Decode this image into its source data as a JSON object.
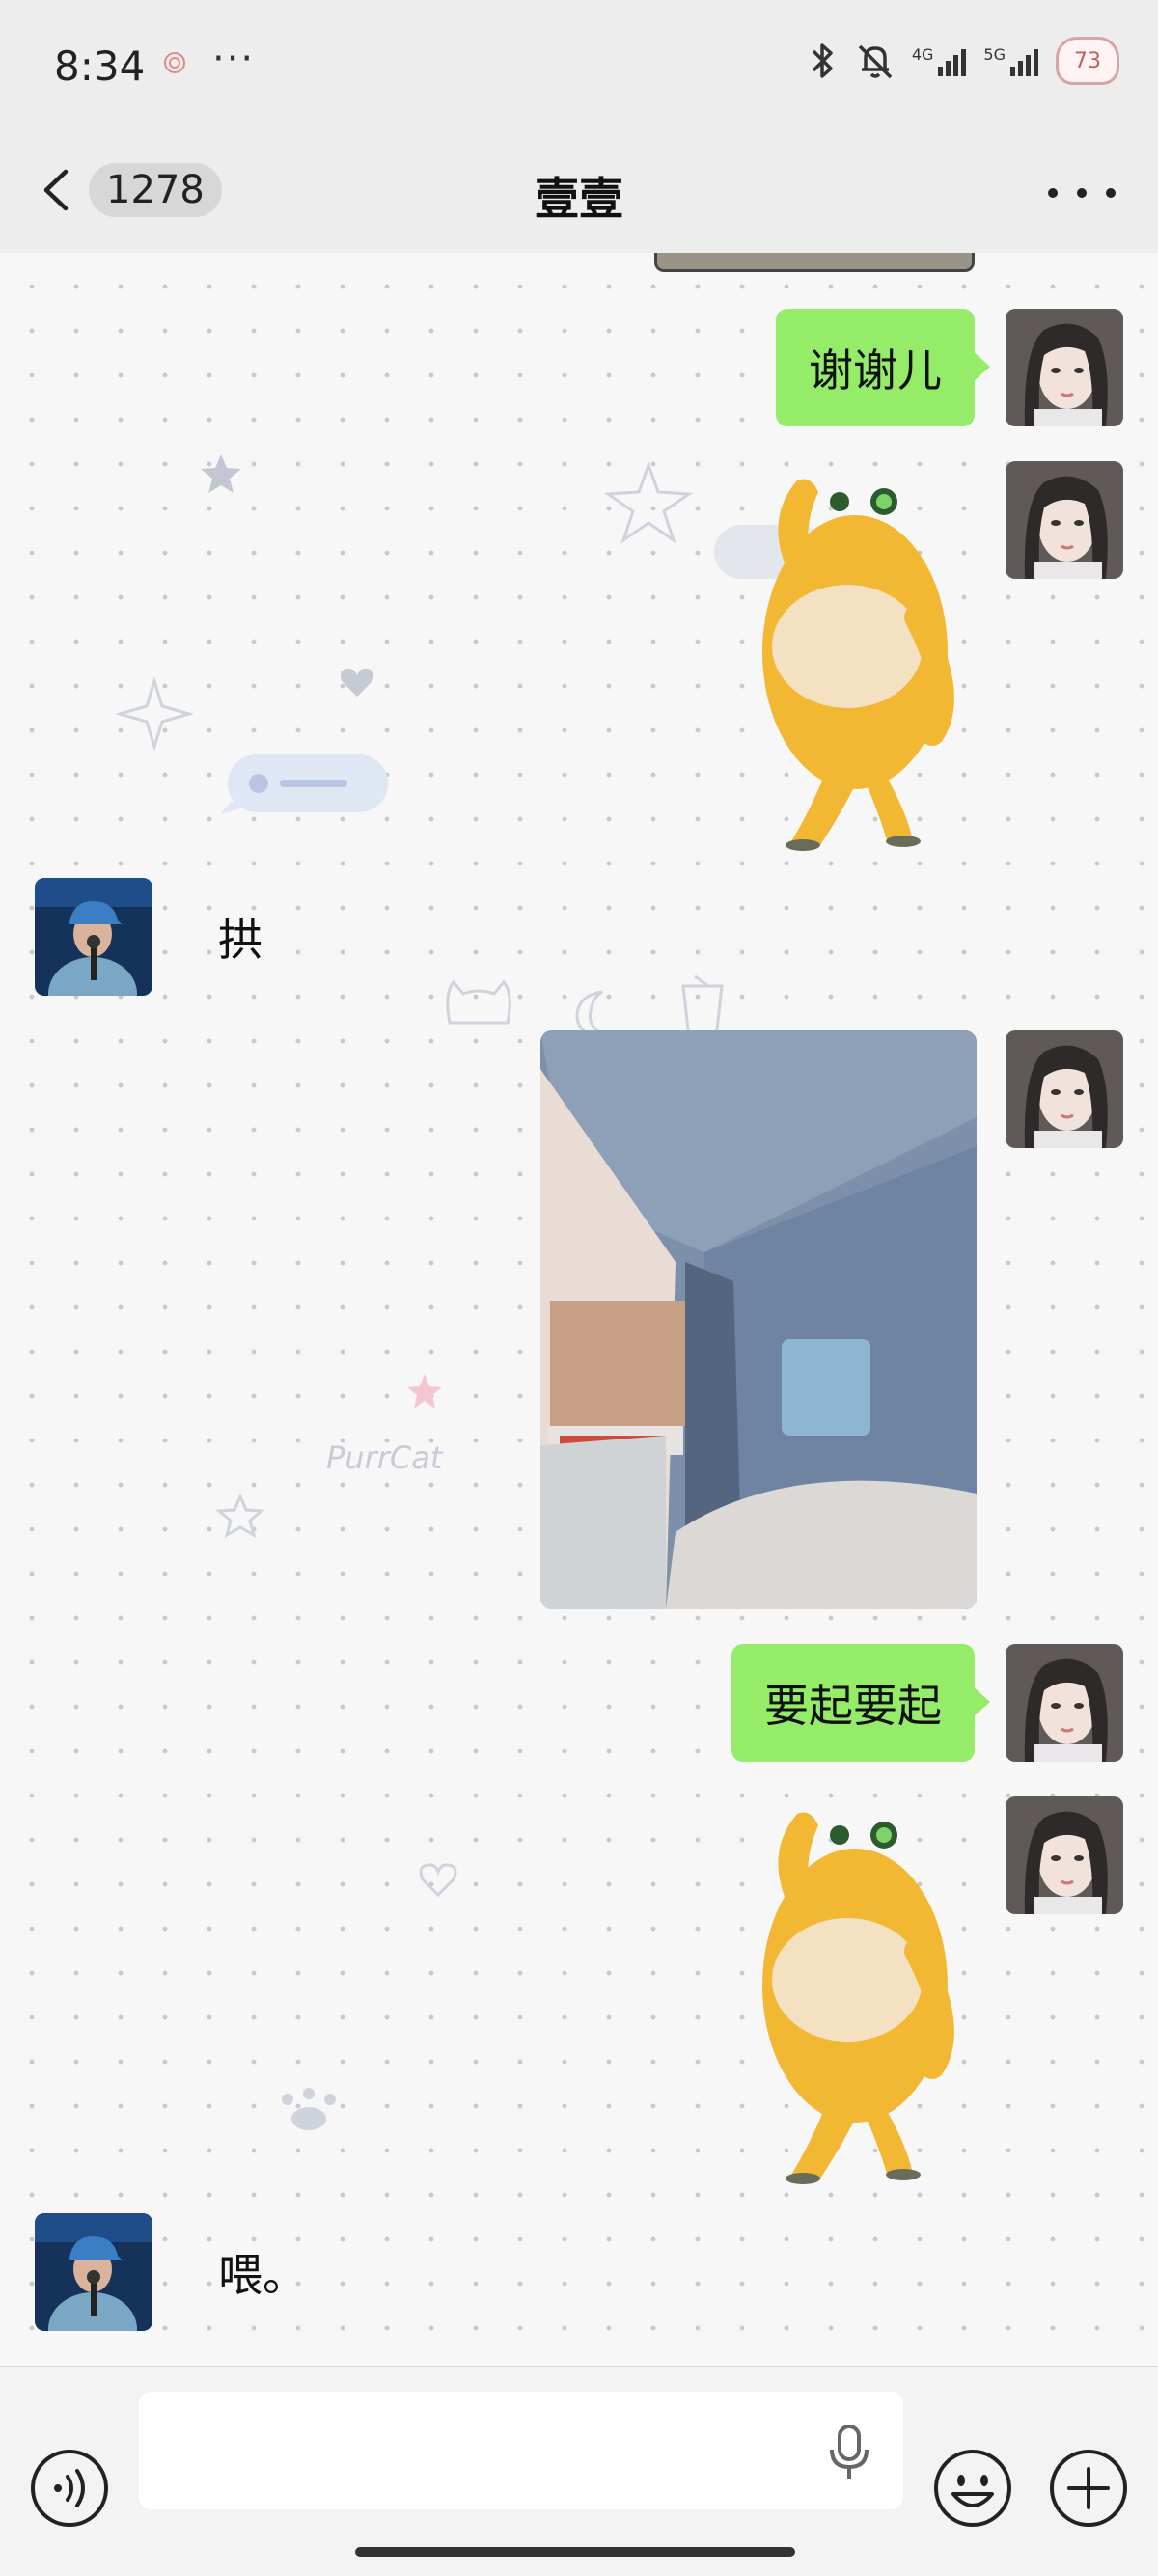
{
  "status_bar": {
    "time": "8:34",
    "overflow": "···",
    "net_4g": "4G",
    "net_5g": "5G",
    "battery": "73"
  },
  "header": {
    "unread_count": "1278",
    "title": "壹壹"
  },
  "messages": [
    {
      "side": "out",
      "kind": "text",
      "text": "谢谢儿"
    },
    {
      "side": "out",
      "kind": "sticker",
      "icon": "yellow-creature-sticker"
    },
    {
      "side": "in",
      "kind": "text",
      "text": "拱"
    },
    {
      "side": "out",
      "kind": "image",
      "icon": "bed-curtain-photo"
    },
    {
      "side": "out",
      "kind": "text",
      "text": "要起要起"
    },
    {
      "side": "out",
      "kind": "sticker",
      "icon": "yellow-creature-sticker"
    },
    {
      "side": "in",
      "kind": "text",
      "text": "喂。"
    }
  ],
  "background_decor": {
    "watermark": "PurrCat"
  },
  "input_bar": {
    "placeholder": "",
    "icons": [
      "voice-icon",
      "microphone-icon",
      "emoji-icon",
      "plus-icon"
    ]
  },
  "colors": {
    "bubble_out": "#95ec69",
    "bar_bg": "#ededed",
    "badge_bg": "#d7d7d7"
  }
}
